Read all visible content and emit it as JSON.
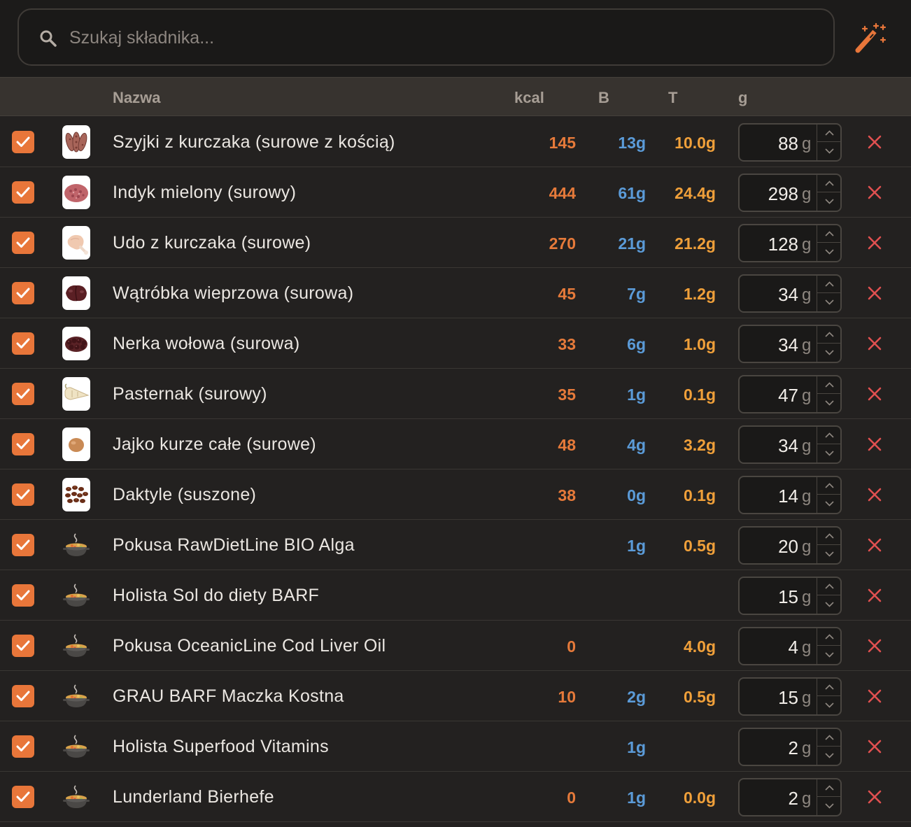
{
  "search": {
    "placeholder": "Szukaj składnika...",
    "value": ""
  },
  "toolbar": {
    "magic_icon": "magic-wand-icon"
  },
  "table": {
    "headers": {
      "name": "Nazwa",
      "kcal": "kcal",
      "protein": "B",
      "fat": "T",
      "grams": "g"
    },
    "rows": [
      {
        "checked": true,
        "thumb": "chicken-necks",
        "name": "Szyjki z kurczaka (surowe z kością)",
        "kcal": "145",
        "protein": "13g",
        "fat": "10.0g",
        "qty": "88",
        "unit": "g"
      },
      {
        "checked": true,
        "thumb": "ground-turkey",
        "name": "Indyk mielony (surowy)",
        "kcal": "444",
        "protein": "61g",
        "fat": "24.4g",
        "qty": "298",
        "unit": "g"
      },
      {
        "checked": true,
        "thumb": "chicken-thigh",
        "name": "Udo z kurczaka (surowe)",
        "kcal": "270",
        "protein": "21g",
        "fat": "21.2g",
        "qty": "128",
        "unit": "g"
      },
      {
        "checked": true,
        "thumb": "pork-liver",
        "name": "Wątróbka wieprzowa (surowa)",
        "kcal": "45",
        "protein": "7g",
        "fat": "1.2g",
        "qty": "34",
        "unit": "g"
      },
      {
        "checked": true,
        "thumb": "beef-kidney",
        "name": "Nerka wołowa (surowa)",
        "kcal": "33",
        "protein": "6g",
        "fat": "1.0g",
        "qty": "34",
        "unit": "g"
      },
      {
        "checked": true,
        "thumb": "parsnip",
        "name": "Pasternak (surowy)",
        "kcal": "35",
        "protein": "1g",
        "fat": "0.1g",
        "qty": "47",
        "unit": "g"
      },
      {
        "checked": true,
        "thumb": "egg",
        "name": "Jajko kurze całe (surowe)",
        "kcal": "48",
        "protein": "4g",
        "fat": "3.2g",
        "qty": "34",
        "unit": "g"
      },
      {
        "checked": true,
        "thumb": "dates",
        "name": "Daktyle (suszone)",
        "kcal": "38",
        "protein": "0g",
        "fat": "0.1g",
        "qty": "14",
        "unit": "g"
      },
      {
        "checked": true,
        "thumb": "pot",
        "name": "Pokusa RawDietLine BIO Alga",
        "kcal": "",
        "protein": "1g",
        "fat": "0.5g",
        "qty": "20",
        "unit": "g"
      },
      {
        "checked": true,
        "thumb": "pot",
        "name": "Holista Sol do diety BARF",
        "kcal": "",
        "protein": "",
        "fat": "",
        "qty": "15",
        "unit": "g"
      },
      {
        "checked": true,
        "thumb": "pot",
        "name": "Pokusa OceanicLine Cod Liver Oil",
        "kcal": "0",
        "protein": "",
        "fat": "4.0g",
        "qty": "4",
        "unit": "g"
      },
      {
        "checked": true,
        "thumb": "pot",
        "name": "GRAU BARF Maczka Kostna",
        "kcal": "10",
        "protein": "2g",
        "fat": "0.5g",
        "qty": "15",
        "unit": "g"
      },
      {
        "checked": true,
        "thumb": "pot",
        "name": "Holista Superfood Vitamins",
        "kcal": "",
        "protein": "1g",
        "fat": "",
        "qty": "2",
        "unit": "g"
      },
      {
        "checked": true,
        "thumb": "pot",
        "name": "Lunderland Bierhefe",
        "kcal": "0",
        "protein": "1g",
        "fat": "0.0g",
        "qty": "2",
        "unit": "g"
      }
    ]
  },
  "colors": {
    "accent": "#e8763a",
    "kcal": "#e67a3a",
    "protein": "#5b9bd8",
    "fat": "#f0a03a",
    "delete": "#e05050"
  }
}
